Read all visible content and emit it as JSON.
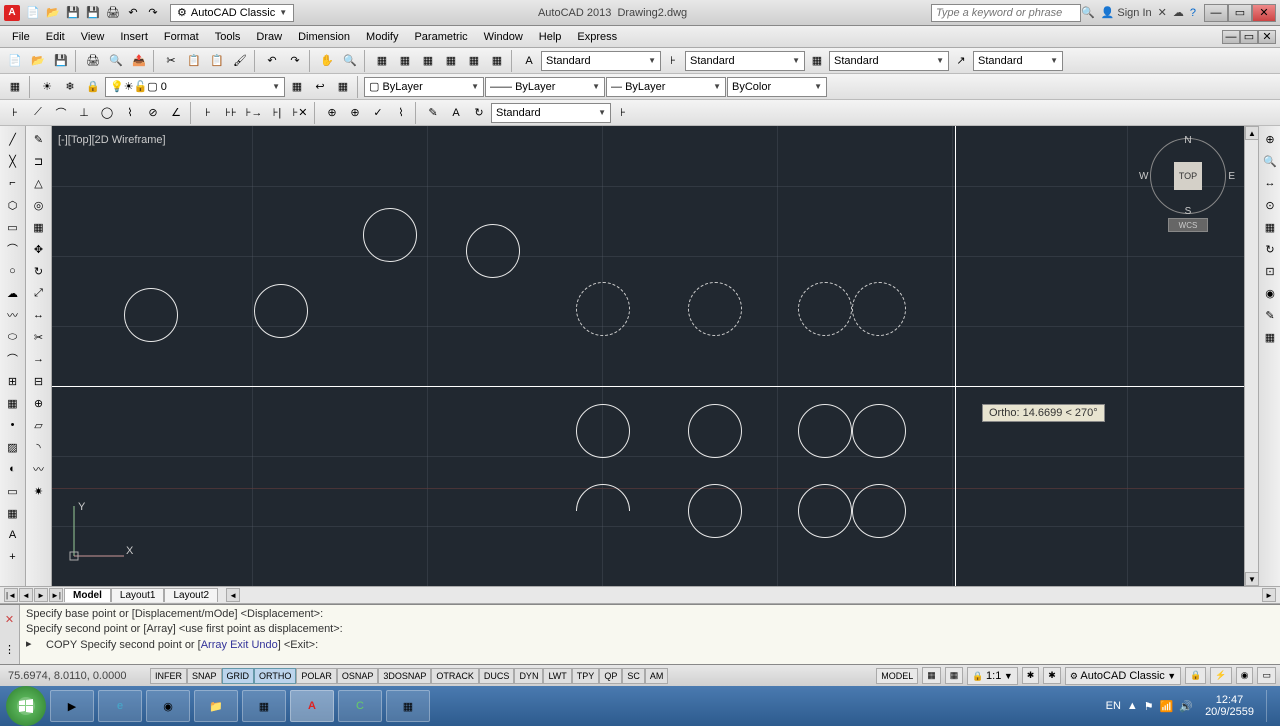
{
  "title": {
    "app": "AutoCAD 2013",
    "doc": "Drawing2.dwg"
  },
  "qat": {
    "workspace": "AutoCAD Classic"
  },
  "search": {
    "placeholder": "Type a keyword or phrase"
  },
  "sign_in": "Sign In",
  "menus": [
    "File",
    "Edit",
    "View",
    "Insert",
    "Format",
    "Tools",
    "Draw",
    "Dimension",
    "Modify",
    "Parametric",
    "Window",
    "Help",
    "Express"
  ],
  "styles": {
    "text": "Standard",
    "dim": "Standard",
    "table": "Standard",
    "mleader": "Standard"
  },
  "layers": {
    "current": "0",
    "layer_combo": "ByLayer",
    "ltype": "ByLayer",
    "lweight": "ByLayer",
    "plot": "ByColor"
  },
  "dim_toolbar": {
    "style": "Standard"
  },
  "viewport": {
    "label": "[-][Top][2D Wireframe]"
  },
  "viewcube": {
    "face": "TOP",
    "wcs": "WCS"
  },
  "ortho_tip": "Ortho: 14.6699 < 270°",
  "tabs": {
    "nav": [
      "|◄",
      "◄",
      "►",
      "►|"
    ],
    "items": [
      "Model",
      "Layout1",
      "Layout2"
    ],
    "active": 0
  },
  "cmd": {
    "line1": "Specify base point or [Displacement/mOde] <Displacement>:",
    "line2": "Specify second point or [Array] <use first point as displacement>:",
    "cur_cmd": "COPY",
    "cur_prompt": "Specify second point or [",
    "cur_opts": [
      "Array",
      "Exit",
      "Undo"
    ],
    "cur_end": "] <Exit>:"
  },
  "status": {
    "coords": "75.6974, 8.0110, 0.0000",
    "toggles": [
      "INFER",
      "SNAP",
      "GRID",
      "ORTHO",
      "POLAR",
      "OSNAP",
      "3DOSNAP",
      "OTRACK",
      "DUCS",
      "DYN",
      "LWT",
      "TPY",
      "QP",
      "SC",
      "AM"
    ],
    "on": [
      2,
      3
    ],
    "model": "MODEL",
    "scale": "1:1",
    "ws": "AutoCAD Classic"
  },
  "tray": {
    "lang": "EN",
    "time": "12:47",
    "date": "20/9/2559"
  }
}
